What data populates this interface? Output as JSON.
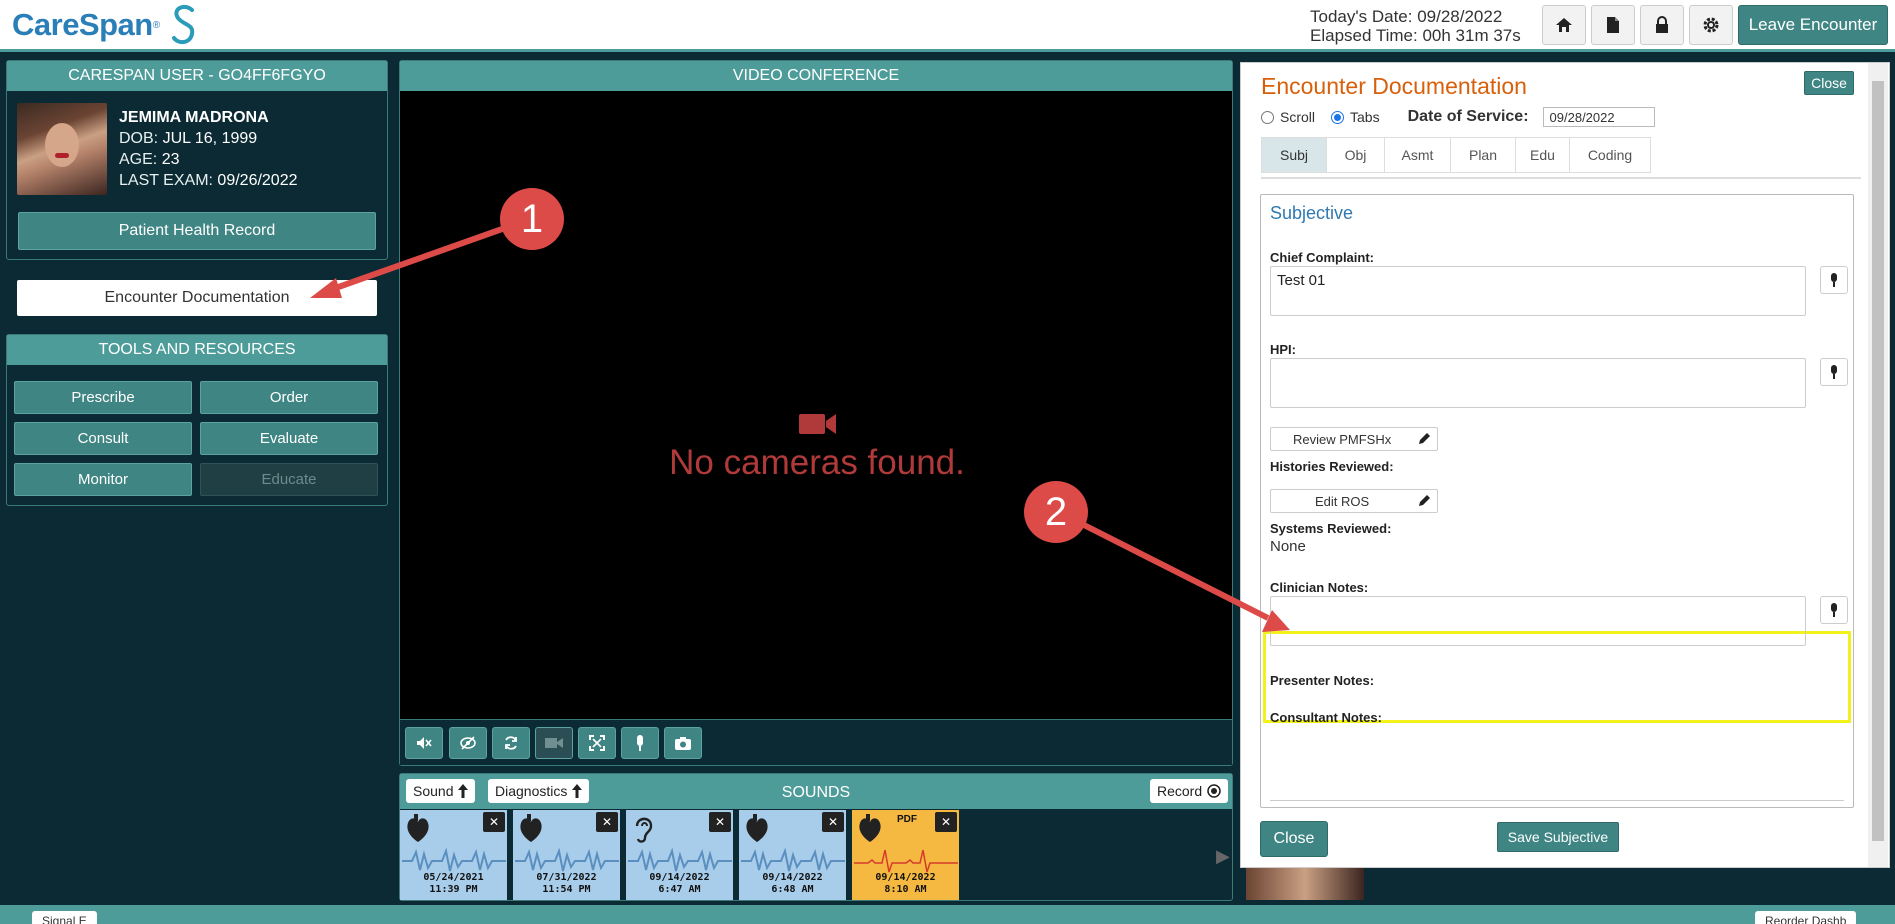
{
  "header": {
    "logo_text": "CareSpan",
    "logo_reg": "®",
    "today_date": "Today's Date: 09/28/2022",
    "elapsed_time": "Elapsed Time: 00h 31m 37s",
    "icons": [
      "home-icon",
      "document-icon",
      "lock-icon",
      "gear-icon"
    ],
    "leave_label": "Leave Encounter"
  },
  "patient_panel": {
    "title": "CARESPAN USER - GO4FF6FGYO",
    "name": "JEMIMA MADRONA",
    "dob_label": "DOB:",
    "dob": "JUL 16, 1999",
    "age_label": "AGE:",
    "age": "23",
    "last_exam_label": "LAST EXAM:",
    "last_exam": "09/26/2022",
    "phr_label": "Patient Health Record"
  },
  "encounter_doc_label": "Encounter Documentation",
  "tools": {
    "title": "TOOLS AND RESOURCES",
    "buttons": [
      "Prescribe",
      "Order",
      "Consult",
      "Evaluate",
      "Monitor",
      "Educate"
    ]
  },
  "video": {
    "title": "VIDEO CONFERENCE",
    "message": "No cameras found."
  },
  "sounds": {
    "title": "SOUNDS",
    "sound_label": "Sound",
    "diagnostics_label": "Diagnostics",
    "record_label": "Record",
    "items": [
      {
        "date": "05/24/2021",
        "time": "11:39 PM",
        "icon": "heart-icon"
      },
      {
        "date": "07/31/2022",
        "time": "11:54 PM",
        "icon": "heart-icon"
      },
      {
        "date": "09/14/2022",
        "time": "6:47 AM",
        "icon": "ear-icon"
      },
      {
        "date": "09/14/2022",
        "time": "6:48 AM",
        "icon": "heart-icon"
      },
      {
        "date": "09/14/2022",
        "time": "8:10 AM",
        "icon": "heart-icon",
        "badge": "PDF"
      }
    ]
  },
  "modal": {
    "title": "Encounter Documentation",
    "close_top": "Close",
    "scroll_label": "Scroll",
    "tabs_label": "Tabs",
    "dos_label": "Date of Service:",
    "dos_value": "09/28/2022",
    "tabs": [
      "Subj",
      "Obj",
      "Asmt",
      "Plan",
      "Edu",
      "Coding"
    ],
    "section_title": "Subjective",
    "chief_complaint_label": "Chief Complaint:",
    "chief_complaint_value": "Test 01",
    "hpi_label": "HPI:",
    "review_pmfshx": "Review PMFSHx",
    "histories_label": "Histories Reviewed:",
    "edit_ros": "Edit ROS",
    "systems_label": "Systems Reviewed:",
    "systems_value": "None",
    "clinician_label": "Clinician Notes:",
    "presenter_label": "Presenter Notes:",
    "consultant_label": "Consultant Notes:",
    "save_label": "Save Subjective",
    "close_bottom": "Close"
  },
  "bottom": {
    "left_pill": "Signal E",
    "right_pill": "Reorder Dashb"
  },
  "annotations": {
    "badge1": "1",
    "badge2": "2"
  },
  "colors": {
    "teal": "#4d9c99",
    "button_teal": "#3f8583",
    "background": "#0c2a33",
    "annotation_red": "#dd4b48",
    "highlight_yellow": "#f2f21a",
    "modal_title_orange": "#d9600b"
  }
}
